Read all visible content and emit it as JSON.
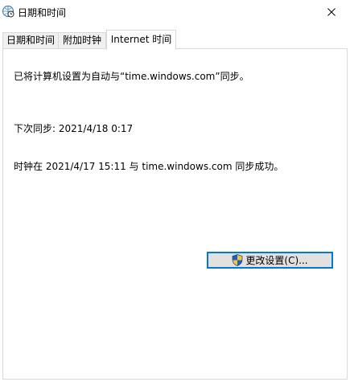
{
  "window": {
    "title": "日期和时间",
    "close_glyph": "✕"
  },
  "tabs": [
    {
      "label": "日期和时间",
      "active": false
    },
    {
      "label": "附加时钟",
      "active": false
    },
    {
      "label": "Internet 时间",
      "active": true
    }
  ],
  "panel": {
    "sync_config_text": "已将计算机设置为自动与“time.windows.com”同步。",
    "next_sync_text": "下次同步: 2021/4/18 0:17",
    "last_sync_text": "时钟在 2021/4/17 15:11 与 time.windows.com 同步成功。",
    "change_settings_label": "更改设置(C)..."
  },
  "icons": {
    "title_icon": "clock-globe-icon",
    "button_icon": "uac-shield-icon"
  },
  "colors": {
    "accent": "#0078d7",
    "tab_border": "#d9d9d9",
    "button_face": "#e1e1e1"
  }
}
